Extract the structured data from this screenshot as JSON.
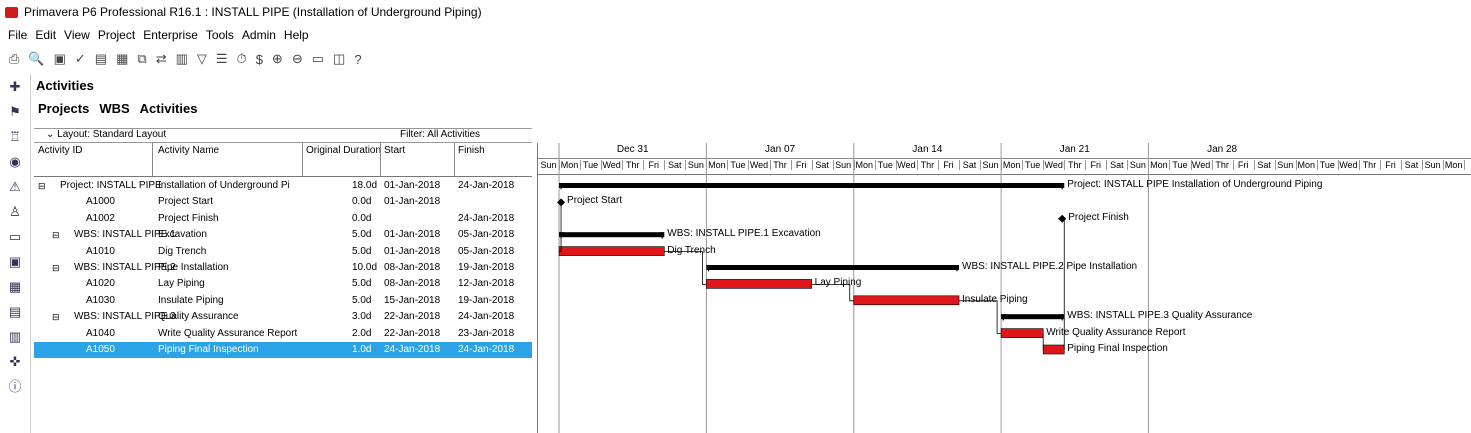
{
  "window": {
    "title": "Primavera P6 Professional R16.1 : INSTALL PIPE (Installation of Underground Piping)"
  },
  "menu": [
    "File",
    "Edit",
    "View",
    "Project",
    "Enterprise",
    "Tools",
    "Admin",
    "Help"
  ],
  "toolbar_icons": [
    "print-icon",
    "print-preview-icon",
    "page-setup-icon",
    "spell-check-icon",
    "open-icon",
    "save-icon",
    "copy-icon",
    "link-icon",
    "columns-icon",
    "filter-icon",
    "group-icon",
    "schedule-icon",
    "level-icon",
    "zoom-in-icon",
    "zoom-out-icon",
    "layout-icon",
    "notebook-icon",
    "help-icon"
  ],
  "sidebar_icons": [
    "activities-icon",
    "projects-icon",
    "wbs-icon",
    "resources-icon",
    "reports-icon",
    "tracking-icon",
    "issues-icon",
    "risks-icon",
    "thresholds-icon",
    "documents-icon",
    "expenses-icon",
    "codes-icon",
    "info-icon"
  ],
  "main": {
    "title": "Activities",
    "crumbs": [
      "Projects",
      "WBS",
      "Activities"
    ]
  },
  "layout_label": "Layout: Standard Layout",
  "filter_label": "Filter: All Activities",
  "columns": {
    "id": "Activity ID",
    "name": "Activity Name",
    "duration": "Original Duration",
    "start": "Start",
    "finish": "Finish"
  },
  "rows": [
    {
      "id": "Project: INSTALL PIPE",
      "name": "Installation of Underground Pi",
      "dur": "18.0d",
      "start": "01-Jan-2018",
      "finish": "24-Jan-2018",
      "level": 0,
      "expand": "⊟"
    },
    {
      "id": "A1000",
      "name": "Project Start",
      "dur": "0.0d",
      "start": "01-Jan-2018",
      "finish": "",
      "level": 2,
      "expand": ""
    },
    {
      "id": "A1002",
      "name": "Project Finish",
      "dur": "0.0d",
      "start": "",
      "finish": "24-Jan-2018",
      "level": 2,
      "expand": ""
    },
    {
      "id": "WBS: INSTALL PIPE.1",
      "name": "Excavation",
      "dur": "5.0d",
      "start": "01-Jan-2018",
      "finish": "05-Jan-2018",
      "level": 1,
      "expand": "⊟"
    },
    {
      "id": "A1010",
      "name": "Dig Trench",
      "dur": "5.0d",
      "start": "01-Jan-2018",
      "finish": "05-Jan-2018",
      "level": 2,
      "expand": ""
    },
    {
      "id": "WBS: INSTALL PIPE.2",
      "name": "Pipe Installation",
      "dur": "10.0d",
      "start": "08-Jan-2018",
      "finish": "19-Jan-2018",
      "level": 1,
      "expand": "⊟"
    },
    {
      "id": "A1020",
      "name": "Lay Piping",
      "dur": "5.0d",
      "start": "08-Jan-2018",
      "finish": "12-Jan-2018",
      "level": 2,
      "expand": ""
    },
    {
      "id": "A1030",
      "name": "Insulate Piping",
      "dur": "5.0d",
      "start": "15-Jan-2018",
      "finish": "19-Jan-2018",
      "level": 2,
      "expand": ""
    },
    {
      "id": "WBS: INSTALL PIPE.3",
      "name": "Quality Assurance",
      "dur": "3.0d",
      "start": "22-Jan-2018",
      "finish": "24-Jan-2018",
      "level": 1,
      "expand": "⊟"
    },
    {
      "id": "A1040",
      "name": "Write Quality Assurance Report",
      "dur": "2.0d",
      "start": "22-Jan-2018",
      "finish": "23-Jan-2018",
      "level": 2,
      "expand": ""
    },
    {
      "id": "A1050",
      "name": "Piping Final Inspection",
      "dur": "1.0d",
      "start": "24-Jan-2018",
      "finish": "24-Jan-2018",
      "level": 2,
      "expand": "",
      "selected": true
    }
  ],
  "gantt": {
    "weeks": [
      "Dec 31",
      "Jan 07",
      "Jan 14",
      "Jan 21",
      "Jan 28"
    ],
    "days": [
      "Sun",
      "Mon",
      "Tue",
      "Wed",
      "Thr",
      "Fri",
      "Sat"
    ],
    "labels": [
      "Project: INSTALL PIPE  Installation of Underground Piping",
      "Project Start",
      "Project Finish",
      "WBS: INSTALL PIPE.1  Excavation",
      "Dig Trench",
      "WBS: INSTALL PIPE.2  Pipe Installation",
      "Lay Piping",
      "Insulate Piping",
      "WBS: INSTALL PIPE.3  Quality Assurance",
      "Write Quality Assurance Report",
      "Piping Final Inspection"
    ],
    "colors": {
      "summary": "#000000",
      "activity": "#e0161b",
      "selected": "#2ca3e6"
    }
  }
}
